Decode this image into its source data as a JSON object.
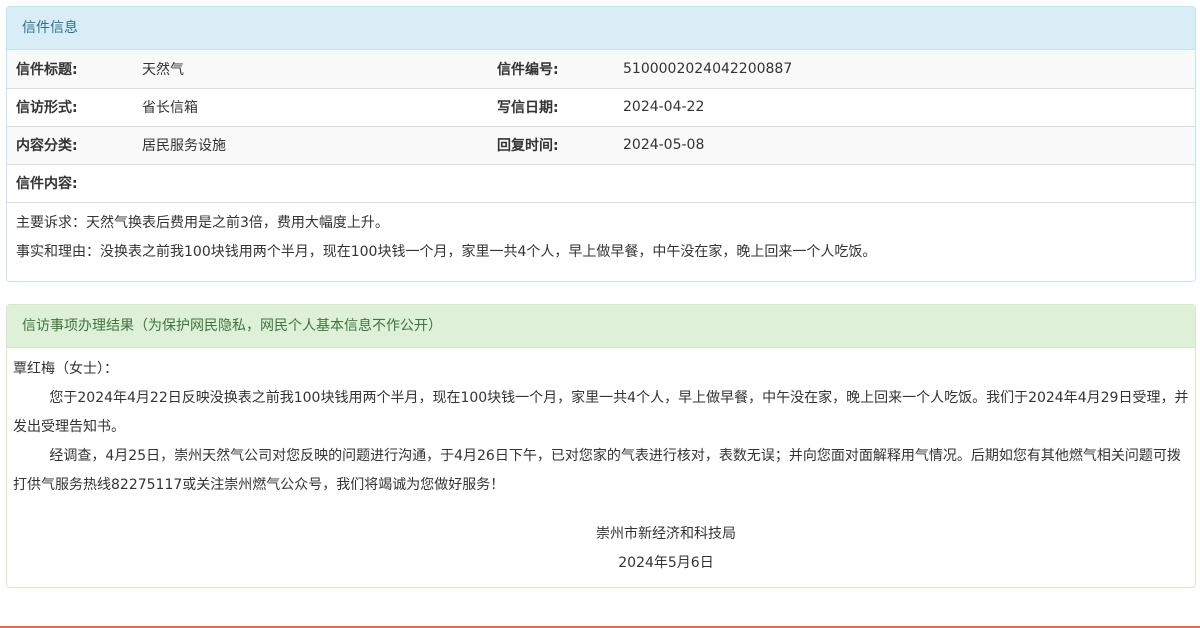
{
  "letter_panel": {
    "title": "信件信息",
    "rows": [
      {
        "label1": "信件标题:",
        "value1": "天然气",
        "label2": "信件编号:",
        "value2": "5100002024042200887"
      },
      {
        "label1": "信访形式:",
        "value1": "省长信箱",
        "label2": "写信日期:",
        "value2": "2024-04-22"
      },
      {
        "label1": "内容分类:",
        "value1": "居民服务设施",
        "label2": "回复时间:",
        "value2": "2024-05-08"
      }
    ],
    "content_label": "信件内容:",
    "content_lines": [
      "主要诉求：天然气换表后费用是之前3倍，费用大幅度上升。",
      "事实和理由：没换表之前我100块钱用两个半月，现在100块钱一个月，家里一共4个人，早上做早餐，中午没在家，晚上回来一个人吃饭。"
    ]
  },
  "result_panel": {
    "title": "信访事项办理结果（为保护网民隐私，网民个人基本信息不作公开）",
    "salutation": "覃红梅（女士）：",
    "para1": "您于2024年4月22日反映没换表之前我100块钱用两个半月，现在100块钱一个月，家里一共4个人，早上做早餐，中午没在家，晚上回来一个人吃饭。我们于2024年4月29日受理，并发出受理告知书。",
    "para2": "经调查，4月25日，崇州天然气公司对您反映的问题进行沟通，于4月26日下午，已对您家的气表进行核对，表数无误；并向您面对面解释用气情况。后期如您有其他燃气相关问题可拨打供气服务热线82275117或关注崇州燃气公众号，我们将竭诚为您做好服务！",
    "signature_org": "崇州市新经济和科技局",
    "signature_date": "2024年5月6日"
  },
  "colors": {
    "info_heading_bg": "#d9edf7",
    "info_text": "#31708f",
    "success_heading_bg": "#dff0d8",
    "success_text": "#3c763d",
    "accent_line": "#e36c4c"
  }
}
